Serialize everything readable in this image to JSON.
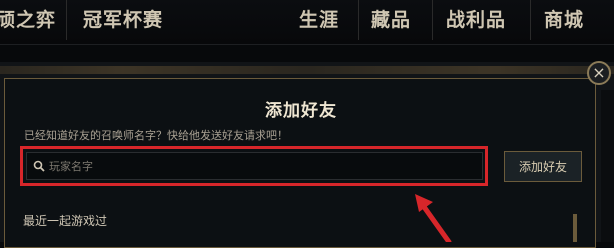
{
  "nav": {
    "items": [
      {
        "label": "顽之弈"
      },
      {
        "label": "冠军杯赛"
      },
      {
        "label": "生涯"
      },
      {
        "label": "藏品"
      },
      {
        "label": "战利品"
      },
      {
        "label": "商城"
      }
    ]
  },
  "dialog": {
    "title": "添加好友",
    "subtitle": "已经知道好友的召唤师名字？快给他发送好友请求吧！",
    "search": {
      "placeholder": "玩家名字",
      "value": ""
    },
    "add_button_label": "添加好友",
    "recent_label": "最近一起游戏过",
    "close_label": "×"
  },
  "colors": {
    "highlight": "#d7262a",
    "gold_border": "#6b5b3b"
  }
}
